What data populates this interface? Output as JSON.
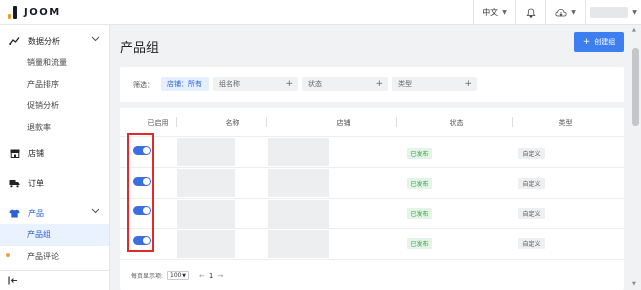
{
  "brand": {
    "name": "JOOM"
  },
  "topbar": {
    "language": "中文",
    "bell_icon": "bell-icon",
    "cloud_icon": "cloud-icon"
  },
  "sidebar": {
    "groups": [
      {
        "label": "数据分析",
        "icon": "chart-icon",
        "children": [
          "销量和流量",
          "产品排序",
          "促销分析",
          "退款率"
        ]
      },
      {
        "label": "店铺",
        "icon": "store-icon"
      },
      {
        "label": "订单",
        "icon": "truck-icon"
      },
      {
        "label": "产品",
        "icon": "shirt-icon",
        "children": [
          "产品组",
          "产品评论"
        ]
      }
    ],
    "truncated_item": "相册",
    "active_item": "产品组"
  },
  "page": {
    "title": "产品组",
    "create_button": "创建组",
    "create_button_icon": "+"
  },
  "filters": {
    "label": "筛选：",
    "store_chip": "店铺：所有",
    "name_chip": "组名称",
    "status_chip": "状态",
    "type_chip": "类型"
  },
  "table": {
    "columns": [
      "已启用",
      "名称",
      "店铺",
      "状态",
      "类型"
    ],
    "rows": [
      {
        "enabled": true,
        "status": "已发布",
        "type": "自定义"
      },
      {
        "enabled": true,
        "status": "已发布",
        "type": "自定义"
      },
      {
        "enabled": true,
        "status": "已发布",
        "type": "自定义"
      },
      {
        "enabled": true,
        "status": "已发布",
        "type": "自定义"
      }
    ]
  },
  "pagination": {
    "per_page_label": "每页显示项:",
    "per_page_value": "100",
    "prev": "←",
    "current_page": "1",
    "next": "→"
  },
  "colors": {
    "accent": "#3d7ff0",
    "toggle_on": "#3b6fe0",
    "status_green": "#3b9d4f",
    "highlight_red": "#e02b2b"
  }
}
